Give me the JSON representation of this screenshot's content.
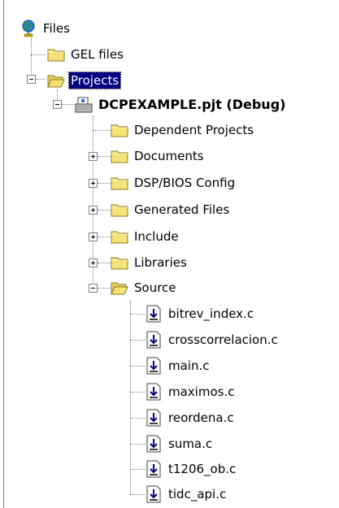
{
  "tree": {
    "root": {
      "label": "Files",
      "icon": "globe-icon"
    },
    "gel": {
      "label": "GEL files",
      "icon": "folder-icon"
    },
    "projects": {
      "label": "Projects",
      "icon": "folder-open-icon",
      "expanded": true,
      "selected": true
    },
    "project": {
      "label": "DCPEXAMPLE.pjt (Debug)",
      "icon": "project-file-icon",
      "expanded": true
    },
    "folders": [
      {
        "label": "Dependent Projects",
        "expandable": false
      },
      {
        "label": "Documents",
        "expandable": true
      },
      {
        "label": "DSP/BIOS Config",
        "expandable": true
      },
      {
        "label": "Generated Files",
        "expandable": true
      },
      {
        "label": "Include",
        "expandable": true
      },
      {
        "label": "Libraries",
        "expandable": true
      },
      {
        "label": "Source",
        "expandable": true,
        "expanded": true
      }
    ],
    "files": [
      {
        "label": "bitrev_index.c"
      },
      {
        "label": "crosscorrelacion.c"
      },
      {
        "label": "main.c"
      },
      {
        "label": "maximos.c"
      },
      {
        "label": "reordena.c"
      },
      {
        "label": "suma.c"
      },
      {
        "label": "t1206_ob.c"
      },
      {
        "label": "tidc_api.c"
      }
    ]
  },
  "colors": {
    "selection": "#000080",
    "folder": "#f7e27a",
    "connector": "#808080"
  }
}
